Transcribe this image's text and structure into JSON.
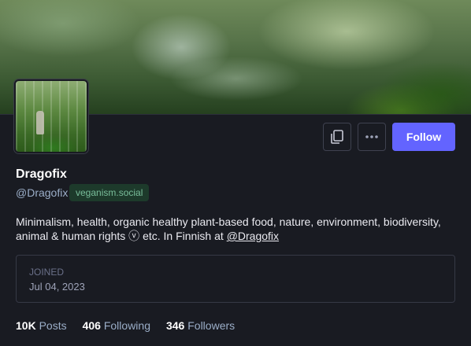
{
  "profile": {
    "display_name": "Dragofix",
    "handle": "@Dragofix",
    "domain_badge": "veganism.social",
    "bio_text": "Minimalism, health, organic healthy plant-based food, nature, environment, biodiversity, animal & human rights ⓥ etc. In Finnish at ",
    "bio_link": "@Dragofix",
    "joined_label": "JOINED",
    "joined_date": "Jul 04, 2023"
  },
  "actions": {
    "copy_icon": "copy-icon",
    "more_icon": "ellipsis-icon",
    "follow_label": "Follow"
  },
  "stats": [
    {
      "value": "10K",
      "label": "Posts"
    },
    {
      "value": "406",
      "label": "Following"
    },
    {
      "value": "346",
      "label": "Followers"
    }
  ],
  "colors": {
    "background": "#191b22",
    "accent": "#6364ff",
    "badge_bg": "#1d3a2b",
    "badge_text": "#79bd9a",
    "muted": "#9baec8"
  }
}
